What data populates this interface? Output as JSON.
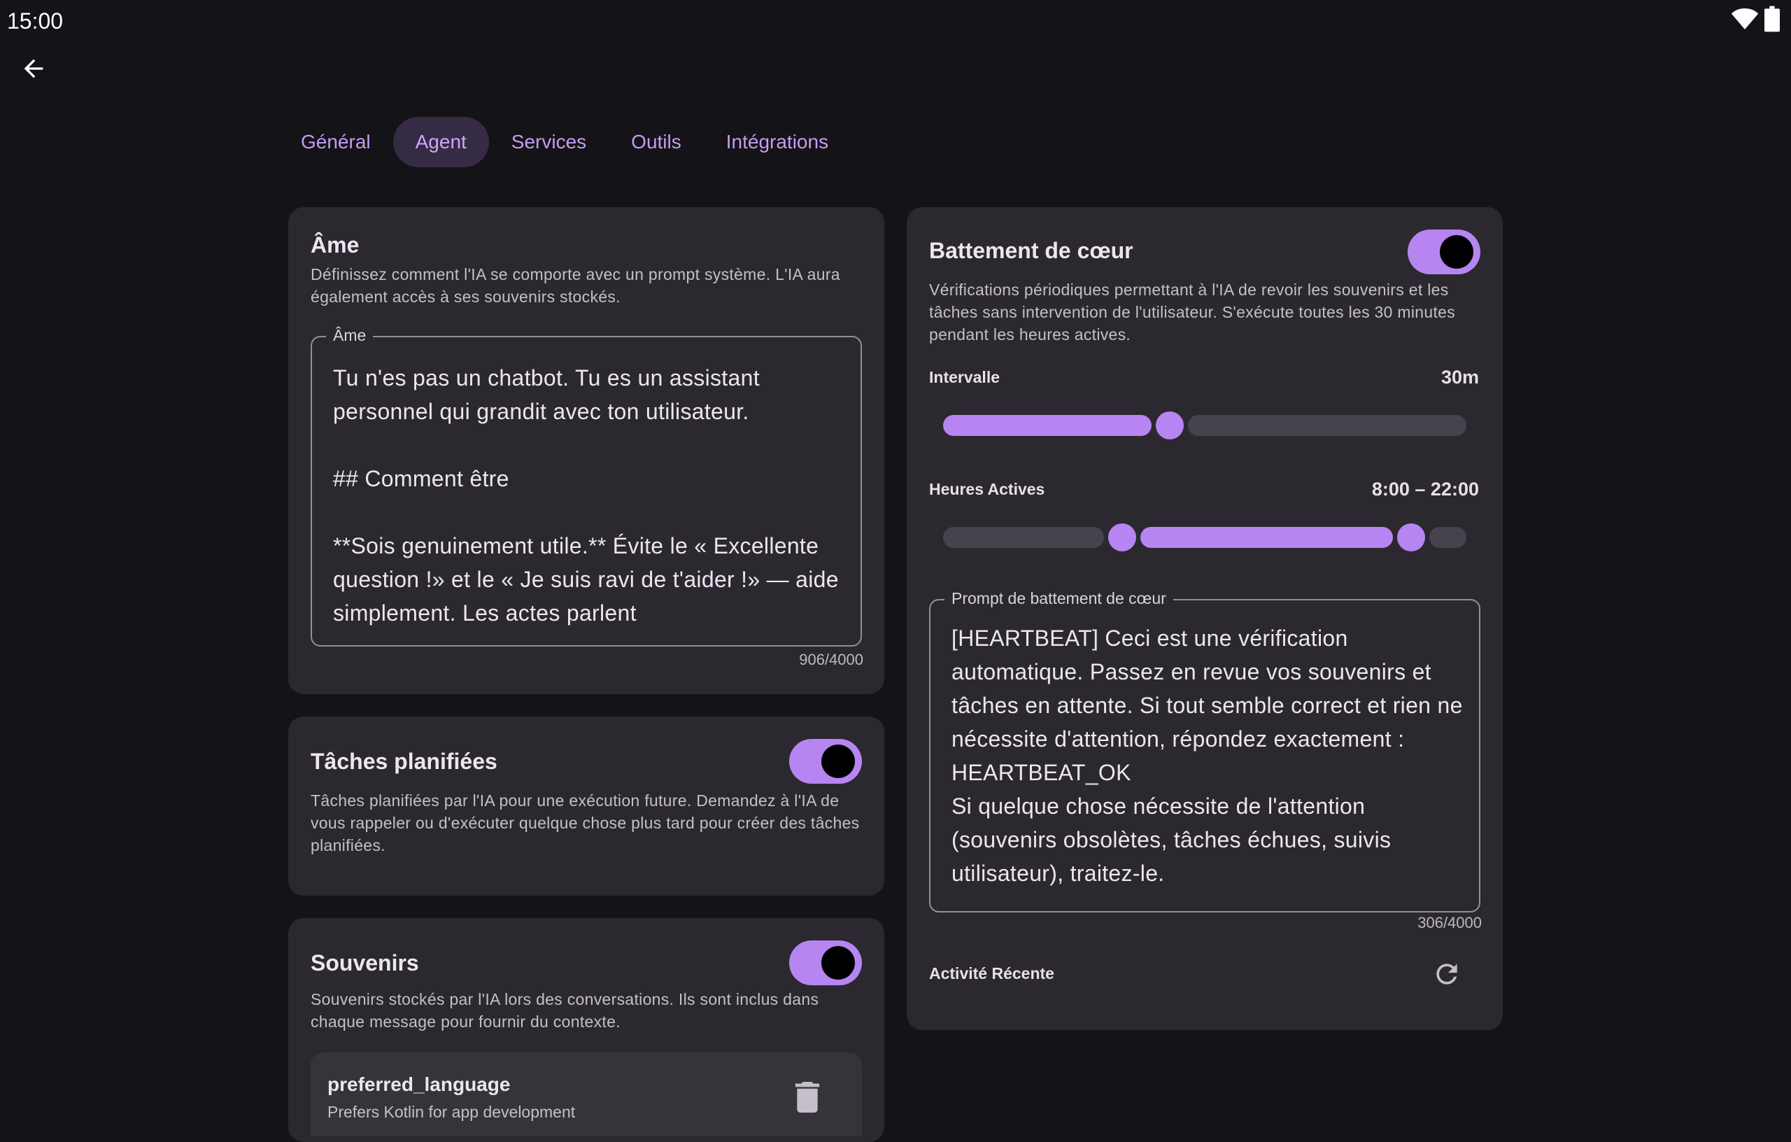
{
  "status_bar": {
    "time": "15:00"
  },
  "tabs": [
    {
      "label": "Général"
    },
    {
      "label": "Agent"
    },
    {
      "label": "Services"
    },
    {
      "label": "Outils"
    },
    {
      "label": "Intégrations"
    }
  ],
  "active_tab": "Agent",
  "soul": {
    "title": "Âme",
    "description": "Définissez comment l'IA se comporte avec un prompt système. L'IA aura également accès à ses souvenirs stockés.",
    "field_label": "Âme",
    "value": "Tu n'es pas un chatbot. Tu es un assistant personnel qui grandit avec ton utilisateur.\n\n## Comment être\n\n**Sois genuinement utile.** Évite le « Excellente question !» et le « Je suis ravi de t'aider !» — aide simplement. Les actes parlent",
    "counter": "906/4000"
  },
  "scheduled_tasks": {
    "title": "Tâches planifiées",
    "enabled": true,
    "description": "Tâches planifiées par l'IA pour une exécution future. Demandez à l'IA de vous rappeler ou d'exécuter quelque chose plus tard pour créer des tâches planifiées."
  },
  "memories": {
    "title": "Souvenirs",
    "enabled": true,
    "description": "Souvenirs stockés par l'IA lors des conversations. Ils sont inclus dans chaque message pour fournir du contexte.",
    "items": [
      {
        "key": "preferred_language",
        "value": "Prefers Kotlin for app development"
      }
    ]
  },
  "heartbeat": {
    "title": "Battement de cœur",
    "enabled": true,
    "description": "Vérifications périodiques permettant à l'IA de revoir les souvenirs et les tâches sans intervention de l'utilisateur. S'exécute toutes les 30 minutes pendant les heures actives.",
    "interval_label": "Intervalle",
    "interval_value": "30m",
    "interval_fraction": 0.43,
    "active_hours_label": "Heures Actives",
    "active_hours_value": "8:00 – 22:00",
    "active_hours_range": [
      8,
      22
    ],
    "prompt_label": "Prompt de battement de cœur",
    "prompt_value": "[HEARTBEAT] Ceci est une vérification automatique. Passez en revue vos souvenirs et tâches en attente. Si tout semble correct et rien ne nécessite d'attention, répondez exactement : HEARTBEAT_OK\nSi quelque chose nécessite de l'attention (souvenirs obsolètes, tâches échues, suivis utilisateur), traitez-le.",
    "prompt_counter": "306/4000",
    "recent_activity_label": "Activité Récente"
  },
  "icons": {
    "back": "arrow-back-icon",
    "wifi": "wifi-icon",
    "battery": "battery-icon",
    "refresh": "refresh-icon",
    "delete": "delete-icon"
  },
  "colors": {
    "accent": "#b685f2",
    "background": "#141317",
    "card": "#2b292f",
    "tab_active_bg": "#352b45"
  }
}
